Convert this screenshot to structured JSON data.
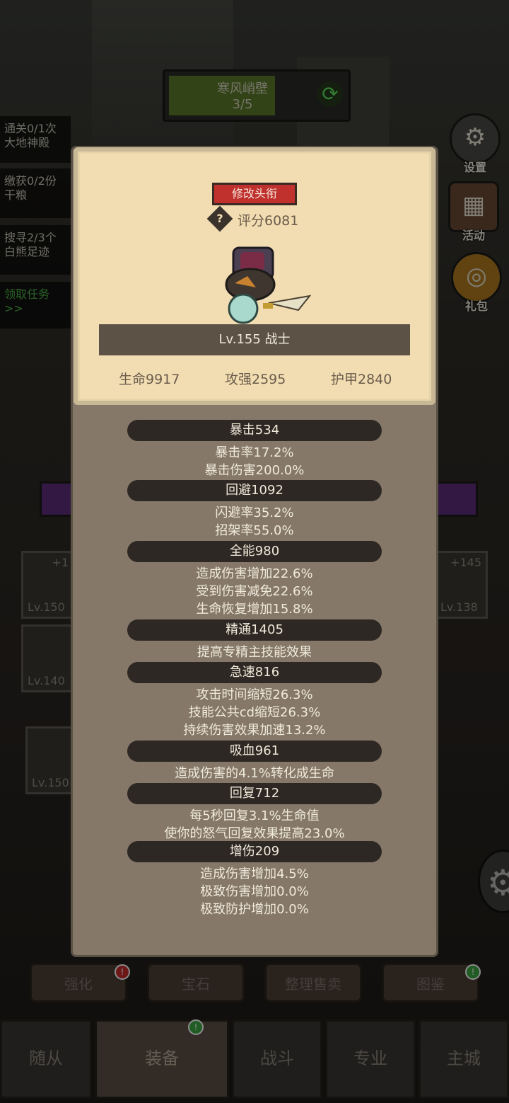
{
  "stage": {
    "title": "寒风峭壁",
    "progress": "3/5"
  },
  "quests": [
    "通关0/1次大地神殿",
    "缴获0/2份干粮",
    "搜寻2/3个白熊足迹",
    "领取任务>>"
  ],
  "side_buttons": {
    "settings": "设置",
    "activity": "活动",
    "gift": "礼包"
  },
  "equip_slots": [
    {
      "plus": "+1",
      "level": "Lv.150"
    },
    {
      "plus": "",
      "level": "Lv.140"
    },
    {
      "plus": "+145",
      "level": "Lv.138"
    },
    {
      "plus": "",
      "level": "Lv.150"
    }
  ],
  "actions": {
    "enhance": "强化",
    "gem": "宝石",
    "sort_sell": "整理售卖",
    "codex": "图鉴"
  },
  "tabs": {
    "followers": "随从",
    "equipment": "装备",
    "battle": "战斗",
    "profession": "专业",
    "main_city": "主城"
  },
  "profile": {
    "rename_label": "修改头衔",
    "score": "评分6081",
    "level_class": "Lv.155 战士",
    "hp": "生命9917",
    "attack": "攻强2595",
    "armor": "护甲2840"
  },
  "stats": {
    "crit": {
      "head": "暴击534",
      "lines": [
        "暴击率17.2%",
        "暴击伤害200.0%"
      ]
    },
    "dodge": {
      "head": "回避1092",
      "lines": [
        "闪避率35.2%",
        "招架率55.0%"
      ]
    },
    "versatility": {
      "head": "全能980",
      "lines": [
        "造成伤害增加22.6%",
        "受到伤害减免22.6%",
        "生命恢复增加15.8%"
      ]
    },
    "mastery": {
      "head": "精通1405",
      "lines": [
        "提高专精主技能效果"
      ]
    },
    "haste": {
      "head": "急速816",
      "lines": [
        "攻击时间缩短26.3%",
        "技能公共cd缩短26.3%",
        "持续伤害效果加速13.2%"
      ]
    },
    "leech": {
      "head": "吸血961",
      "lines": [
        "造成伤害的4.1%转化成生命"
      ]
    },
    "regen": {
      "head": "回复712",
      "lines": [
        "每5秒回复3.1%生命值",
        "使你的怒气回复效果提高23.0%"
      ]
    },
    "dmg_boost": {
      "head": "增伤209",
      "lines": [
        "造成伤害增加4.5%",
        "极致伤害增加0.0%",
        "极致防护增加0.0%"
      ]
    }
  },
  "colors": {
    "card_bg": "#f2ddb2",
    "popup_bg": "#857869",
    "stat_pill": "#2d2823",
    "rename_red": "#c0312e"
  }
}
